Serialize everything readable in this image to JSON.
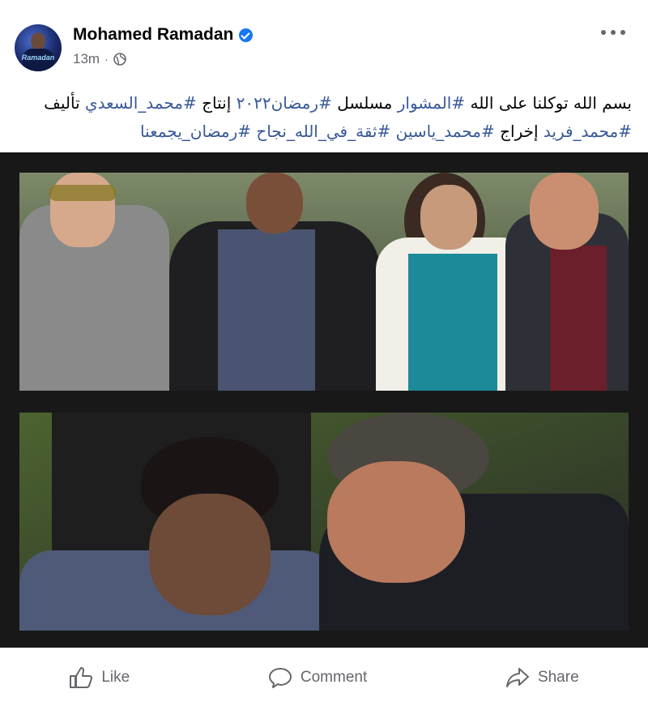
{
  "post": {
    "author": "Mohamed Ramadan",
    "verified": true,
    "time": "13m",
    "separator": "·",
    "privacy_icon": "globe-icon",
    "avatar_text": "Ramadan",
    "text_parts": [
      {
        "t": "بسم الله توكلنا على الله ",
        "tag": false
      },
      {
        "t": "#المشوار",
        "tag": true
      },
      {
        "t": " مسلسل ",
        "tag": false
      },
      {
        "t": "#رمضان٢٠٢٢",
        "tag": true
      },
      {
        "t": " إنتاج ",
        "tag": false
      },
      {
        "t": "#محمد_السعدي",
        "tag": true
      },
      {
        "t": " تأليف ",
        "tag": false
      },
      {
        "t": "#محمد_فريد",
        "tag": true
      },
      {
        "t": " إخراج ",
        "tag": false
      },
      {
        "t": "#محمد_ياسين",
        "tag": true
      },
      {
        "t": " ",
        "tag": false
      },
      {
        "t": "#ثقة_في_الله_نجاح",
        "tag": true
      },
      {
        "t": " ",
        "tag": false
      },
      {
        "t": "#رمضان_يجمعنا",
        "tag": true
      }
    ]
  },
  "actions": {
    "like": "Like",
    "comment": "Comment",
    "share": "Share"
  },
  "colors": {
    "hashtag": "#385898",
    "verified": "#1877f2",
    "meta": "#65676b"
  }
}
